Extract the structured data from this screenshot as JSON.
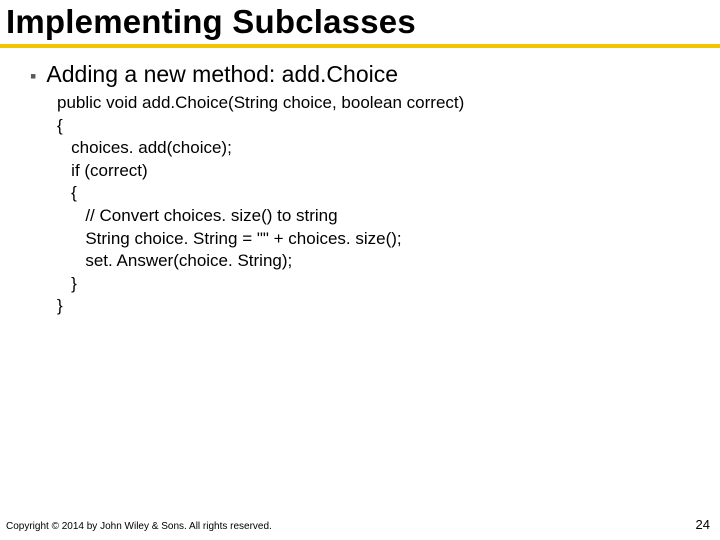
{
  "title": "Implementing Subclasses",
  "bullet": {
    "text_prefix": "Adding a new method: ",
    "method_name": "add.Choice"
  },
  "code_lines": [
    "public void add.Choice(String choice, boolean correct)",
    "{",
    "   choices. add(choice);",
    "   if (correct)",
    "   {",
    "      // Convert choices. size() to string",
    "      String choice. String = \"\" + choices. size();",
    "      set. Answer(choice. String);",
    "   }",
    "}"
  ],
  "footer": "Copyright © 2014 by John Wiley & Sons. All rights reserved.",
  "page_number": "24",
  "colors": {
    "accent_yellow": "#f2c500",
    "bullet_gray": "#595959"
  }
}
